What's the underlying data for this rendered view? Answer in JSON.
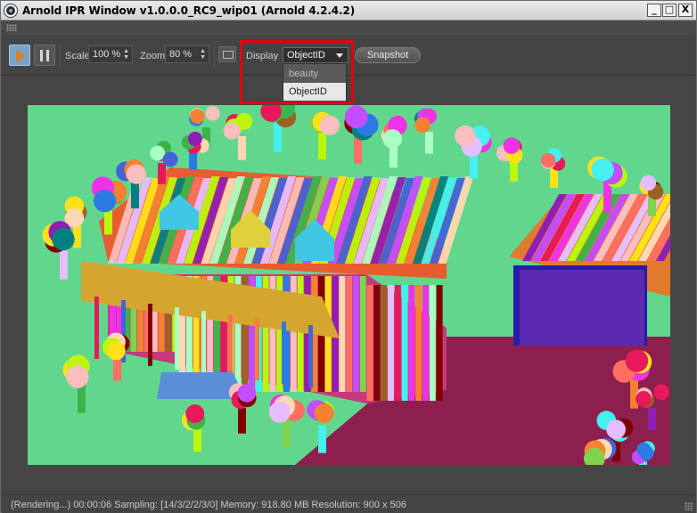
{
  "window": {
    "title": "Arnold IPR Window v1.0.0.0_RC9_wip01 (Arnold 4.2.4.2)",
    "controls": {
      "minimize": "_",
      "maximize": "□",
      "close": "X"
    }
  },
  "toolbar": {
    "play_icon": "play-icon",
    "pause_icon": "pause-icon",
    "scale": {
      "label": "Scale",
      "value": "100 %"
    },
    "zoom": {
      "label": "Zoom",
      "value": "80 %"
    },
    "display": {
      "label": "Display",
      "selected": "ObjectID",
      "options": [
        "beauty",
        "ObjectID"
      ]
    },
    "snapshot_label": "Snapshot",
    "accent_color": "#d9822b",
    "highlight_color": "#e5000e"
  },
  "render": {
    "background_color": "#61d78e",
    "content": "rendered-image"
  },
  "status": {
    "text": "(Rendering...)  00:00:06  Sampling: [14/3/2/2/3/0]  Memory: 918.80 MB  Resolution: 900 x 506"
  }
}
